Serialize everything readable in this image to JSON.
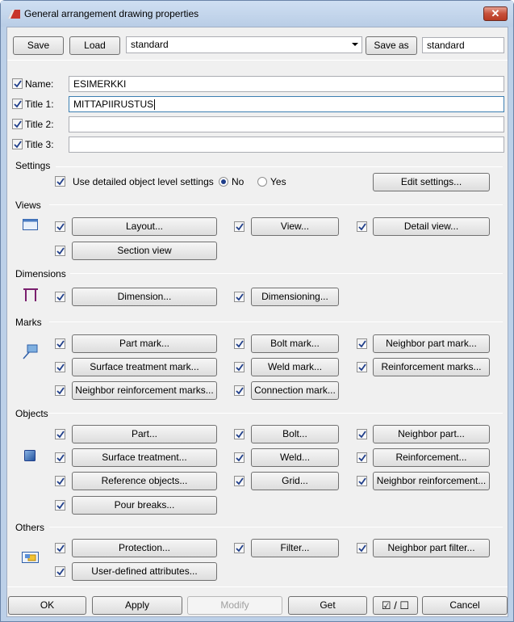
{
  "window": {
    "title": "General arrangement drawing properties",
    "close_label": "✕"
  },
  "top": {
    "save": "Save",
    "load": "Load",
    "settings_value": "standard",
    "save_as": "Save as",
    "save_as_value": "standard"
  },
  "name_fields": {
    "name": {
      "label": "Name:",
      "value": "ESIMERKKI",
      "checked": true
    },
    "title1": {
      "label": "Title 1:",
      "value": "MITTAPIIRUSTUS",
      "checked": true
    },
    "title2": {
      "label": "Title 2:",
      "value": "",
      "checked": true
    },
    "title3": {
      "label": "Title 3:",
      "value": "",
      "checked": true
    }
  },
  "settings": {
    "heading": "Settings",
    "detailed_label": "Use detailed object level settings",
    "no": "No",
    "yes": "Yes",
    "selected": "No",
    "edit_button": "Edit settings..."
  },
  "views": {
    "heading": "Views",
    "layout": "Layout...",
    "view": "View...",
    "detail_view": "Detail view...",
    "section_view": "Section view"
  },
  "dimensions": {
    "heading": "Dimensions",
    "dimension": "Dimension...",
    "dimensioning": "Dimensioning..."
  },
  "marks": {
    "heading": "Marks",
    "part_mark": "Part mark...",
    "bolt_mark": "Bolt mark...",
    "neighbor_part_mark": "Neighbor part mark...",
    "surface_treatment_mark": "Surface treatment mark...",
    "weld_mark": "Weld mark...",
    "reinforcement_marks": "Reinforcement marks...",
    "neighbor_reinforcement_marks": "Neighbor reinforcement marks...",
    "connection_mark": "Connection mark..."
  },
  "objects": {
    "heading": "Objects",
    "part": "Part...",
    "bolt": "Bolt...",
    "neighbor_part": "Neighbor part...",
    "surface_treatment": "Surface treatment...",
    "weld": "Weld...",
    "reinforcement": "Reinforcement...",
    "reference_objects": "Reference objects...",
    "grid": "Grid...",
    "neighbor_reinforcement": "Neighbor reinforcement...",
    "pour_breaks": "Pour breaks..."
  },
  "others": {
    "heading": "Others",
    "protection": "Protection...",
    "filter": "Filter...",
    "neighbor_part_filter": "Neighbor part filter...",
    "user_defined": "User-defined attributes..."
  },
  "bottom": {
    "ok": "OK",
    "apply": "Apply",
    "modify": "Modify",
    "get": "Get",
    "toggle": "☑ / ☐",
    "cancel": "Cancel"
  },
  "icons": {
    "app": "drawing-app-icon",
    "views": "view-window-icon",
    "dimensions": "dimension-icon",
    "marks": "mark-icon",
    "objects": "object-cube-icon",
    "others": "others-folder-icon"
  }
}
